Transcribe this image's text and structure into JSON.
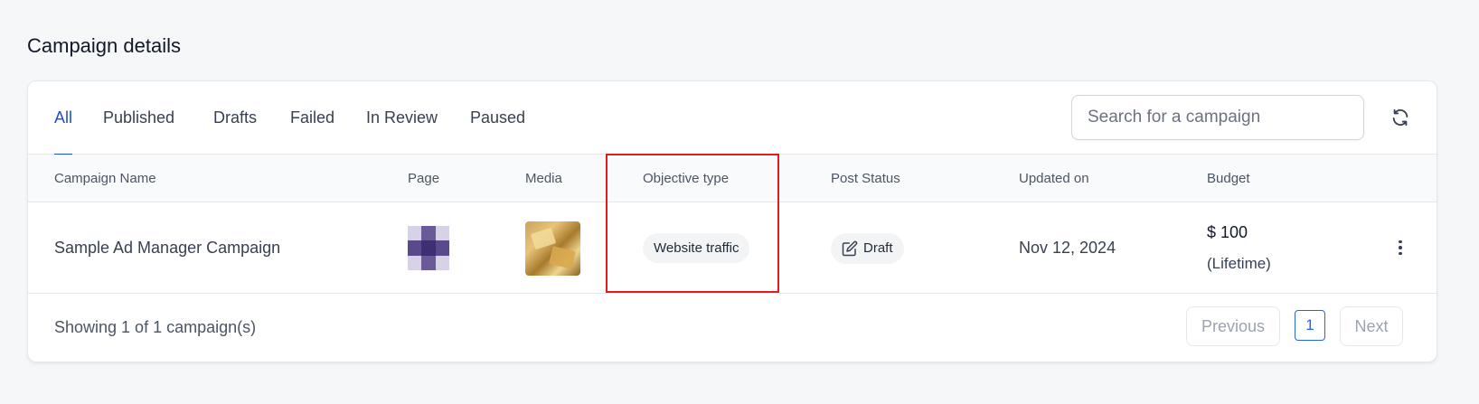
{
  "page": {
    "title": "Campaign details"
  },
  "tabs": [
    {
      "label": "All",
      "active": true
    },
    {
      "label": "Published"
    },
    {
      "label": "Drafts"
    },
    {
      "label": "Failed"
    },
    {
      "label": "In Review"
    },
    {
      "label": "Paused"
    }
  ],
  "search": {
    "placeholder": "Search for a campaign",
    "value": ""
  },
  "icons": {
    "refresh": "refresh-icon",
    "edit": "edit-icon",
    "more": "more-vertical-icon"
  },
  "table": {
    "columns": [
      "Campaign Name",
      "Page",
      "Media",
      "Objective type",
      "Post Status",
      "Updated on",
      "Budget"
    ],
    "rows": [
      {
        "campaign_name": "Sample Ad Manager Campaign",
        "objective_type": "Website traffic",
        "post_status": "Draft",
        "updated_on": "Nov 12, 2024",
        "budget_amount": "$ 100",
        "budget_type": "(Lifetime)"
      }
    ]
  },
  "footer": {
    "showing_text": "Showing 1 of 1 campaign(s)",
    "previous_label": "Previous",
    "next_label": "Next",
    "current_page": "1"
  },
  "colors": {
    "accent": "#1d4ed8",
    "highlight": "#e11d1d",
    "page_avatar_dark": "#4a3a7a",
    "page_avatar_light": "#c9c2de"
  }
}
